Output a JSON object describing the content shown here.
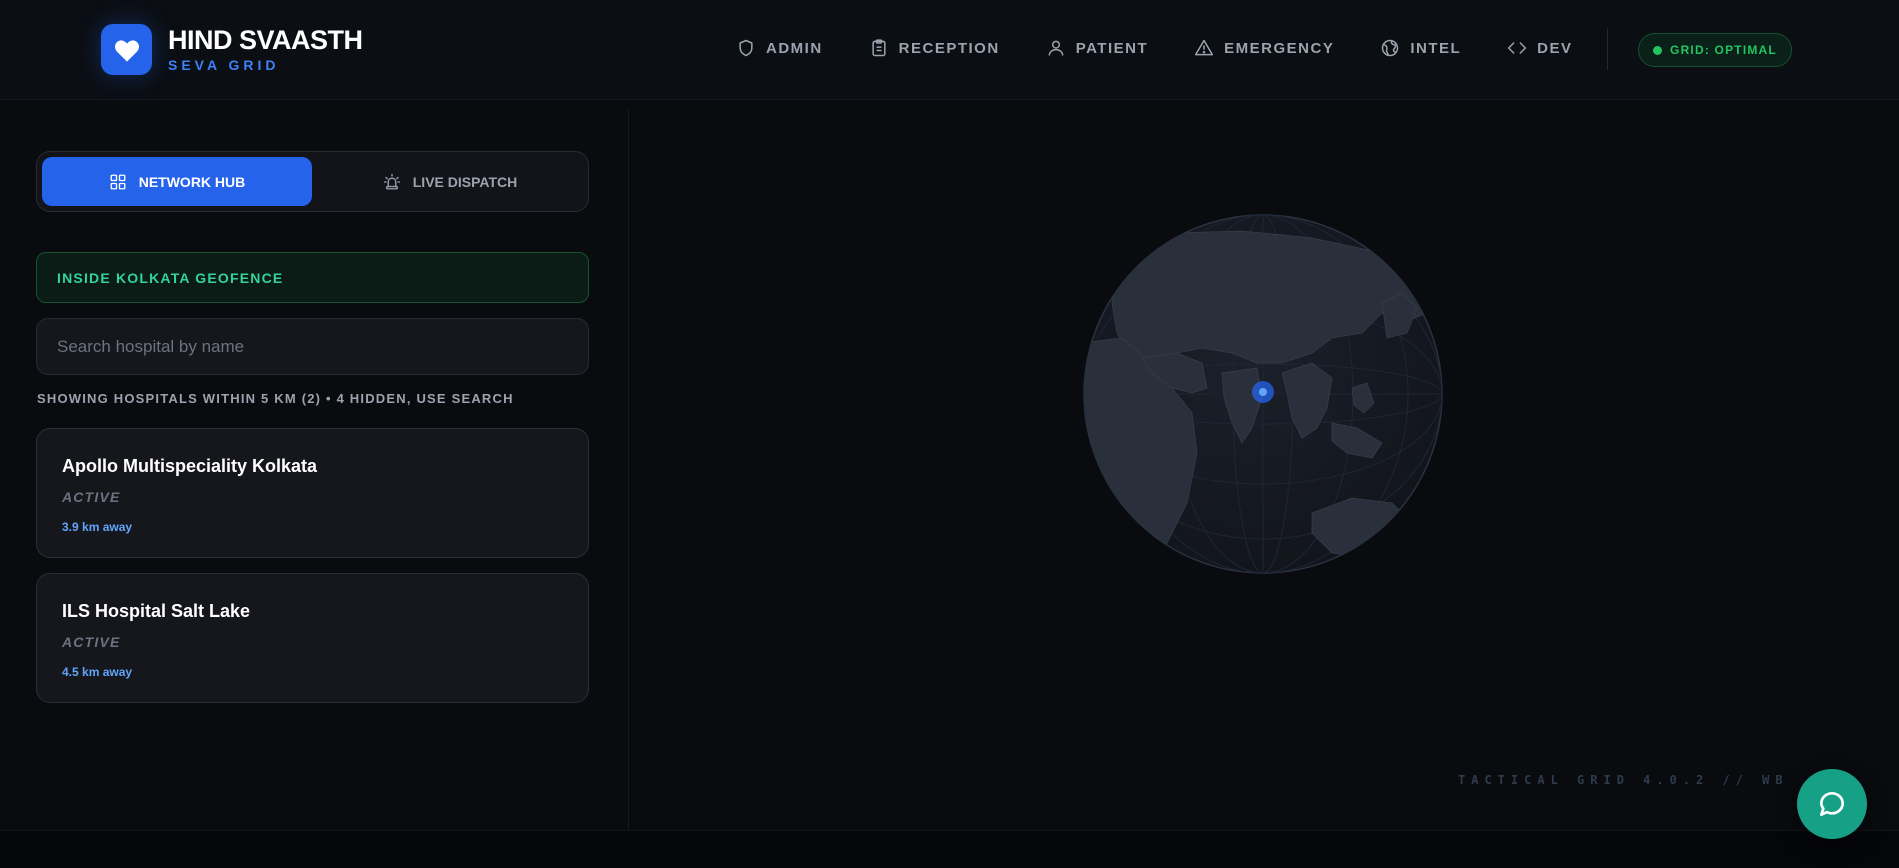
{
  "brand": {
    "title": "HIND SVAASTH",
    "subtitle": "SEVA GRID"
  },
  "nav": {
    "items": [
      {
        "label": "ADMIN",
        "icon": "shield-icon"
      },
      {
        "label": "RECEPTION",
        "icon": "clipboard-icon"
      },
      {
        "label": "PATIENT",
        "icon": "user-icon"
      },
      {
        "label": "EMERGENCY",
        "icon": "warning-icon"
      },
      {
        "label": "INTEL",
        "icon": "globe-icon"
      },
      {
        "label": "DEV",
        "icon": "code-icon"
      }
    ]
  },
  "status": {
    "grid_label": "GRID: OPTIMAL",
    "color": "#22c55e"
  },
  "sidebar": {
    "tabs": [
      {
        "label": "NETWORK HUB",
        "icon": "grid-icon",
        "active": true
      },
      {
        "label": "LIVE DISPATCH",
        "icon": "siren-icon",
        "active": false
      }
    ],
    "geofence": "INSIDE KOLKATA GEOFENCE",
    "search_placeholder": "Search hospital by name",
    "showing": "SHOWING HOSPITALS WITHIN 5 KM (2) • 4 HIDDEN, USE SEARCH",
    "hospitals": [
      {
        "name": "Apollo Multispeciality Kolkata",
        "status": "ACTIVE",
        "distance": "3.9 km away"
      },
      {
        "name": "ILS Hospital Salt Lake",
        "status": "ACTIVE",
        "distance": "4.5 km away"
      }
    ]
  },
  "map": {
    "footer": "TACTICAL GRID 4.0.2 // WB SEC"
  },
  "colors": {
    "accent": "#2563eb",
    "success": "#22c55e",
    "chat": "#16a085"
  }
}
